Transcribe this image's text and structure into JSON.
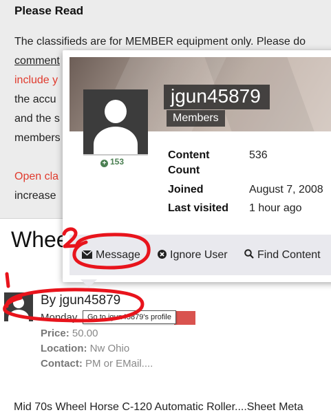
{
  "notice": {
    "title": "Please Read",
    "line1": "The classifieds are for MEMBER equipment only. Please do",
    "line2": "comment",
    "line3": "include y",
    "line4": "the accu",
    "line5": "and the s",
    "line6": "members",
    "line7_red": "Open cla",
    "line8": "increase"
  },
  "page": {
    "title": "Whee"
  },
  "listing": {
    "by": "By jgun45879",
    "date": "Monday",
    "price_label": "Price:",
    "price": "50.00",
    "location_label": "Location:",
    "location": "Nw Ohio",
    "contact_label": "Contact:",
    "contact": "PM or EMail....",
    "description": "Mid 70s Wheel Horse C-120 Automatic Roller....Sheet Meta"
  },
  "tooltip": {
    "text": "Go to jgun45879's profile"
  },
  "card": {
    "username": "jgun45879",
    "group": "Members",
    "reputation": "153",
    "stats": [
      {
        "label_line1": "Content",
        "label_line2": "Count",
        "value": "536"
      },
      {
        "label_line1": "Joined",
        "value": "August 7, 2008"
      },
      {
        "label_line1": "Last visited",
        "value": "1 hour ago"
      }
    ],
    "actions": {
      "message": "Message",
      "ignore": "Ignore User",
      "find": "Find Content"
    }
  },
  "annotations": {
    "one": "1",
    "two": "2",
    "color": "#e8141c"
  },
  "colors": {
    "red_text": "#e03a2d",
    "rep_green": "#4b7f52",
    "badge_red": "#d9534f"
  }
}
